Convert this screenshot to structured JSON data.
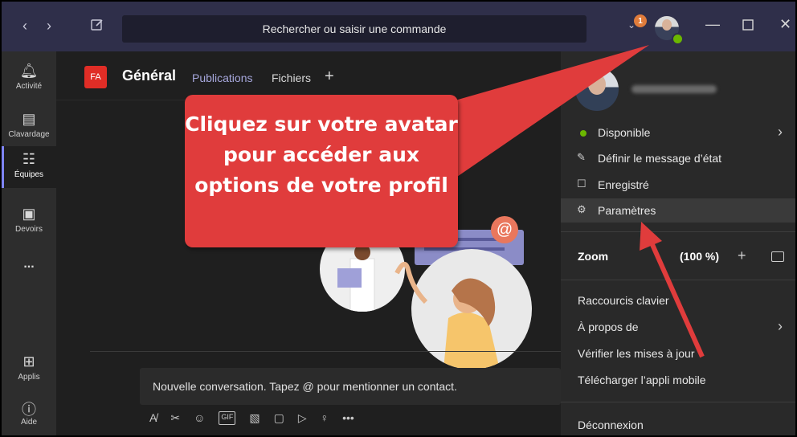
{
  "titlebar": {
    "search_placeholder": "Rechercher ou saisir une commande",
    "notification_count": "1",
    "back_icon": "chevron-left-icon",
    "forward_icon": "chevron-right-icon"
  },
  "rail": {
    "items": [
      {
        "label": "Activité",
        "icon": "bell-icon"
      },
      {
        "label": "Clavardage",
        "icon": "chat-icon"
      },
      {
        "label": "Équipes",
        "icon": "teams-icon"
      },
      {
        "label": "Devoirs",
        "icon": "backpack-icon"
      },
      {
        "label": "...",
        "icon": "more-icon"
      },
      {
        "label": "Applis",
        "icon": "apps-icon"
      },
      {
        "label": "Aide",
        "icon": "help-icon"
      }
    ]
  },
  "channel": {
    "team_initials": "FA",
    "title": "Général",
    "tabs": [
      "Publications",
      "Fichiers"
    ],
    "add_tab": "+"
  },
  "compose": {
    "placeholder": "Nouvelle conversation. Tapez @ pour mentionner un contact."
  },
  "profile_menu": {
    "status": "Disponible",
    "set_status": "Définir le message d’état",
    "saved": "Enregistré",
    "settings": "Paramètres",
    "zoom_label": "Zoom",
    "zoom_value": "(100 %)",
    "shortcuts": "Raccourcis clavier",
    "about": "À propos de",
    "check_updates": "Vérifier les mises à jour",
    "download_mobile": "Télécharger l’appli mobile",
    "logout": "Déconnexion"
  },
  "callout": {
    "text": "Cliquez sur votre avatar pour accéder aux options de votre profil"
  },
  "colors": {
    "titlebar": "#2f2f4a",
    "accent": "#7f85f5",
    "callout": "#e03c3c",
    "presence": "#6bb700"
  }
}
